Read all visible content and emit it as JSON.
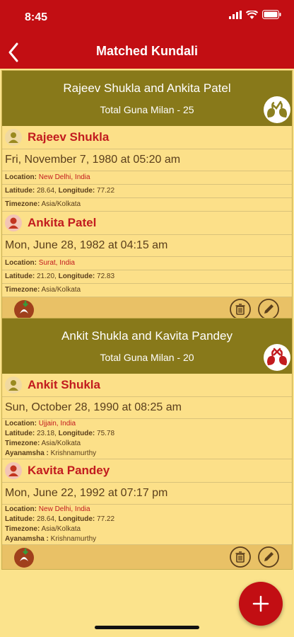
{
  "status": {
    "time": "8:45"
  },
  "header": {
    "title": "Matched Kundali"
  },
  "matches": [
    {
      "pair": "Rajeev Shukla and Ankita Patel",
      "guna": "Total Guna Milan - 25",
      "persons": [
        {
          "name": "Rajeev Shukla",
          "gender": "male",
          "datetime": "Fri, November 7, 1980 at 05:20 am",
          "location_label": "Location:",
          "location": "New Delhi, India",
          "lat_label": "Latitude:",
          "lat": "28.64",
          "lon_label": "Longitude:",
          "lon": "77.22",
          "tz_label": "Timezone:",
          "tz": "Asia/Kolkata"
        },
        {
          "name": "Ankita Patel",
          "gender": "female",
          "datetime": "Mon, June 28, 1982 at 04:15 am",
          "location_label": "Location:",
          "location": "Surat, India",
          "lat_label": "Latitude:",
          "lat": "21.20",
          "lon_label": "Longitude:",
          "lon": "72.83",
          "tz_label": "Timezone:",
          "tz": "Asia/Kolkata"
        }
      ]
    },
    {
      "pair": "Ankit Shukla and Kavita Pandey",
      "guna": "Total Guna Milan - 20",
      "persons": [
        {
          "name": "Ankit Shukla",
          "gender": "male",
          "datetime": "Sun, October 28, 1990 at 08:25 am",
          "location_label": "Location:",
          "location": "Ujjain, India",
          "lat_label": "Latitude:",
          "lat": "23.18",
          "lon_label": "Longitude:",
          "lon": "75.78",
          "tz_label": "Timezone:",
          "tz": "Asia/Kolkata",
          "ayan_label": "Ayanamsha :",
          "ayan": "Krishnamurthy"
        },
        {
          "name": "Kavita Pandey",
          "gender": "female",
          "datetime": "Mon, June 22, 1992 at 07:17 pm",
          "location_label": "Location:",
          "location": "New Delhi, India",
          "lat_label": "Latitude:",
          "lat": "28.64",
          "lon_label": "Longitude:",
          "lon": "77.22",
          "tz_label": "Timezone:",
          "tz": "Asia/Kolkata",
          "ayan_label": "Ayanamsha :",
          "ayan": "Krishnamurthy"
        }
      ]
    }
  ],
  "icons": {
    "back": "back-arrow-icon",
    "good_match": "swans-check-icon",
    "bad_match": "swans-cross-icon",
    "pdf": "pdf-download-icon",
    "delete": "trash-icon",
    "edit": "pencil-icon",
    "add": "plus-icon"
  },
  "colors": {
    "header": "#C20E13",
    "card_head": "#88791A",
    "background": "#FBE38C",
    "name_red": "#C21B1F"
  }
}
